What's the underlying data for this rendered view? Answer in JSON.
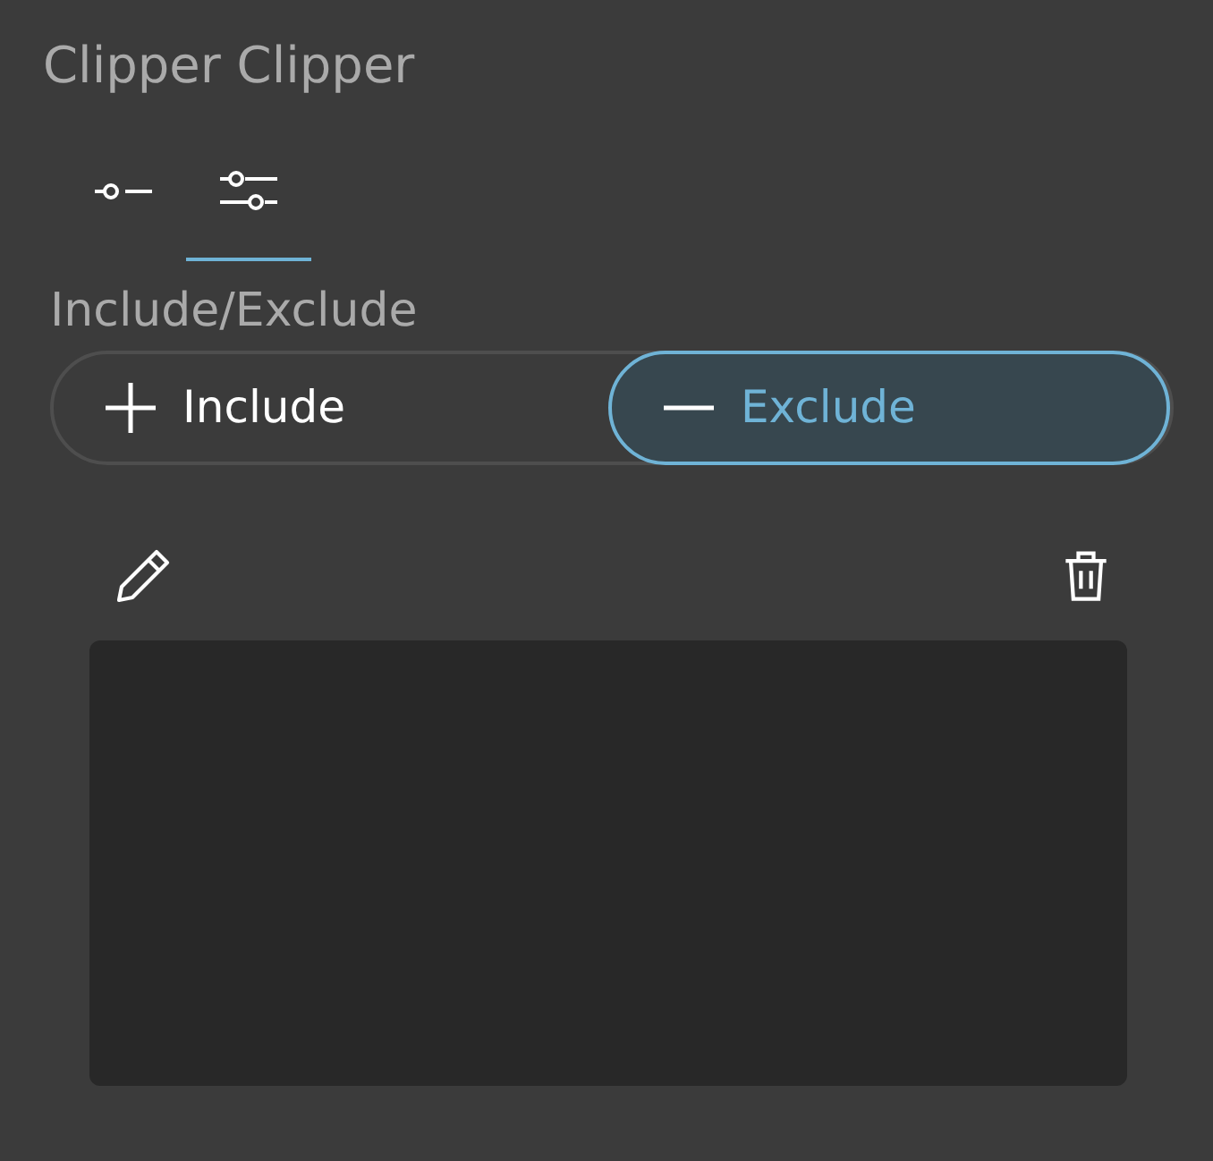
{
  "title": "Clipper Clipper",
  "tabs": [
    {
      "kind": "single",
      "selected": false
    },
    {
      "kind": "double",
      "selected": true
    }
  ],
  "section_label": "Include/Exclude",
  "modes": [
    {
      "kind": "plus",
      "label": "Include",
      "selected": false
    },
    {
      "kind": "minus",
      "label": "Exclude",
      "selected": true
    }
  ]
}
